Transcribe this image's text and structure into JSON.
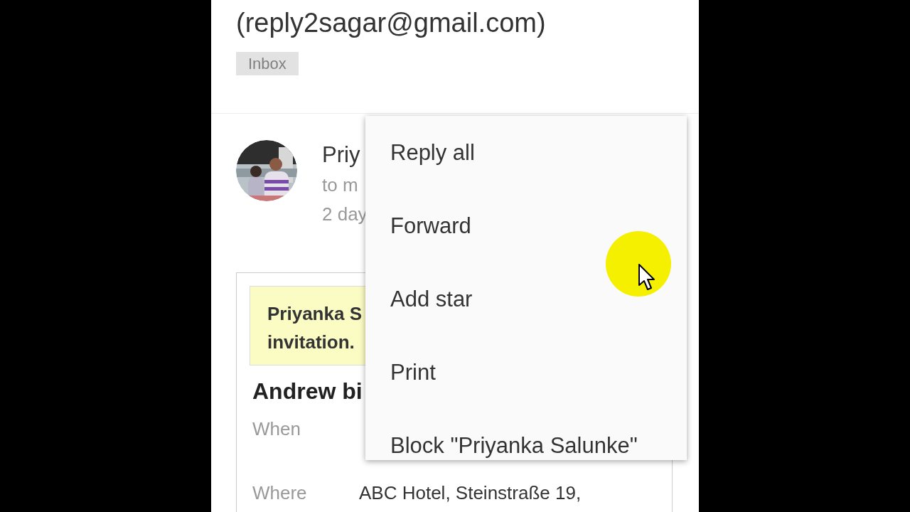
{
  "header": {
    "email": "(reply2sagar@gmail.com)",
    "label": "Inbox"
  },
  "message": {
    "sender": "Priy",
    "recipient": "to m",
    "time": "2 day"
  },
  "invite": {
    "notice_lines": [
      "Priyanka S",
      "invitation."
    ],
    "title": "Andrew bi",
    "details": [
      {
        "label": "When"
      },
      {
        "label": "Where",
        "value": "ABC Hotel, Steinstraße 19,"
      }
    ]
  },
  "menu": {
    "items": [
      {
        "label": "Reply all"
      },
      {
        "label": "Forward"
      },
      {
        "label": "Add star"
      },
      {
        "label": "Print"
      },
      {
        "label": "Block \"Priyanka Salunke\""
      }
    ]
  }
}
